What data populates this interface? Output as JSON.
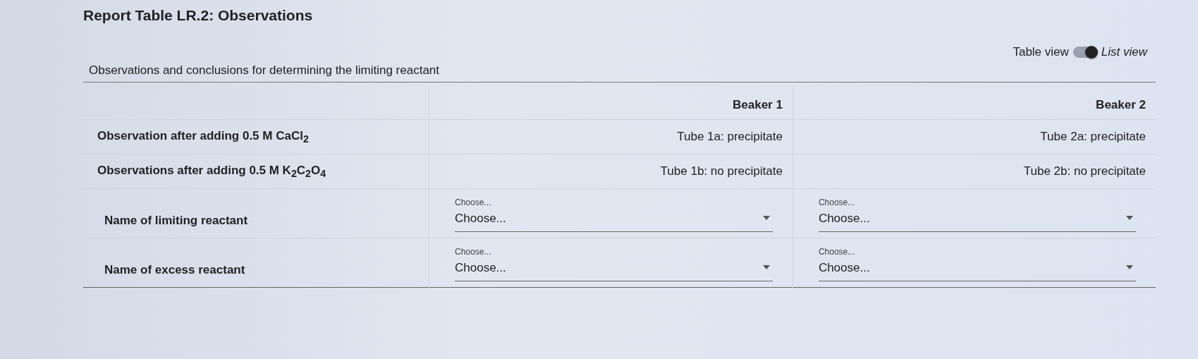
{
  "title": "Report Table LR.2: Observations",
  "view_toggle": {
    "left_label": "Table view",
    "right_label": "List view",
    "on": true
  },
  "caption": "Observations and conclusions for determining the limiting reactant",
  "columns": [
    "Beaker 1",
    "Beaker 2"
  ],
  "rows": [
    {
      "kind": "text",
      "label": "Observation after adding 0.5 M CaCl$_{2}$",
      "cells": [
        "Tube 1a: precipitate",
        "Tube 2a: precipitate"
      ]
    },
    {
      "kind": "text",
      "label": "Observations after adding 0.5 M K$_{2}$C$_{2}$O$_{4}$",
      "cells": [
        "Tube 1b: no precipitate",
        "Tube 2b: no precipitate"
      ]
    },
    {
      "kind": "select",
      "label": "Name of limiting reactant",
      "cells": [
        {
          "floating_label": "Choose...",
          "value": "Choose..."
        },
        {
          "floating_label": "Choose...",
          "value": "Choose..."
        }
      ]
    },
    {
      "kind": "select",
      "label": "Name of excess reactant",
      "cells": [
        {
          "floating_label": "Choose...",
          "value": "Choose..."
        },
        {
          "floating_label": "Choose...",
          "value": "Choose..."
        }
      ]
    }
  ]
}
